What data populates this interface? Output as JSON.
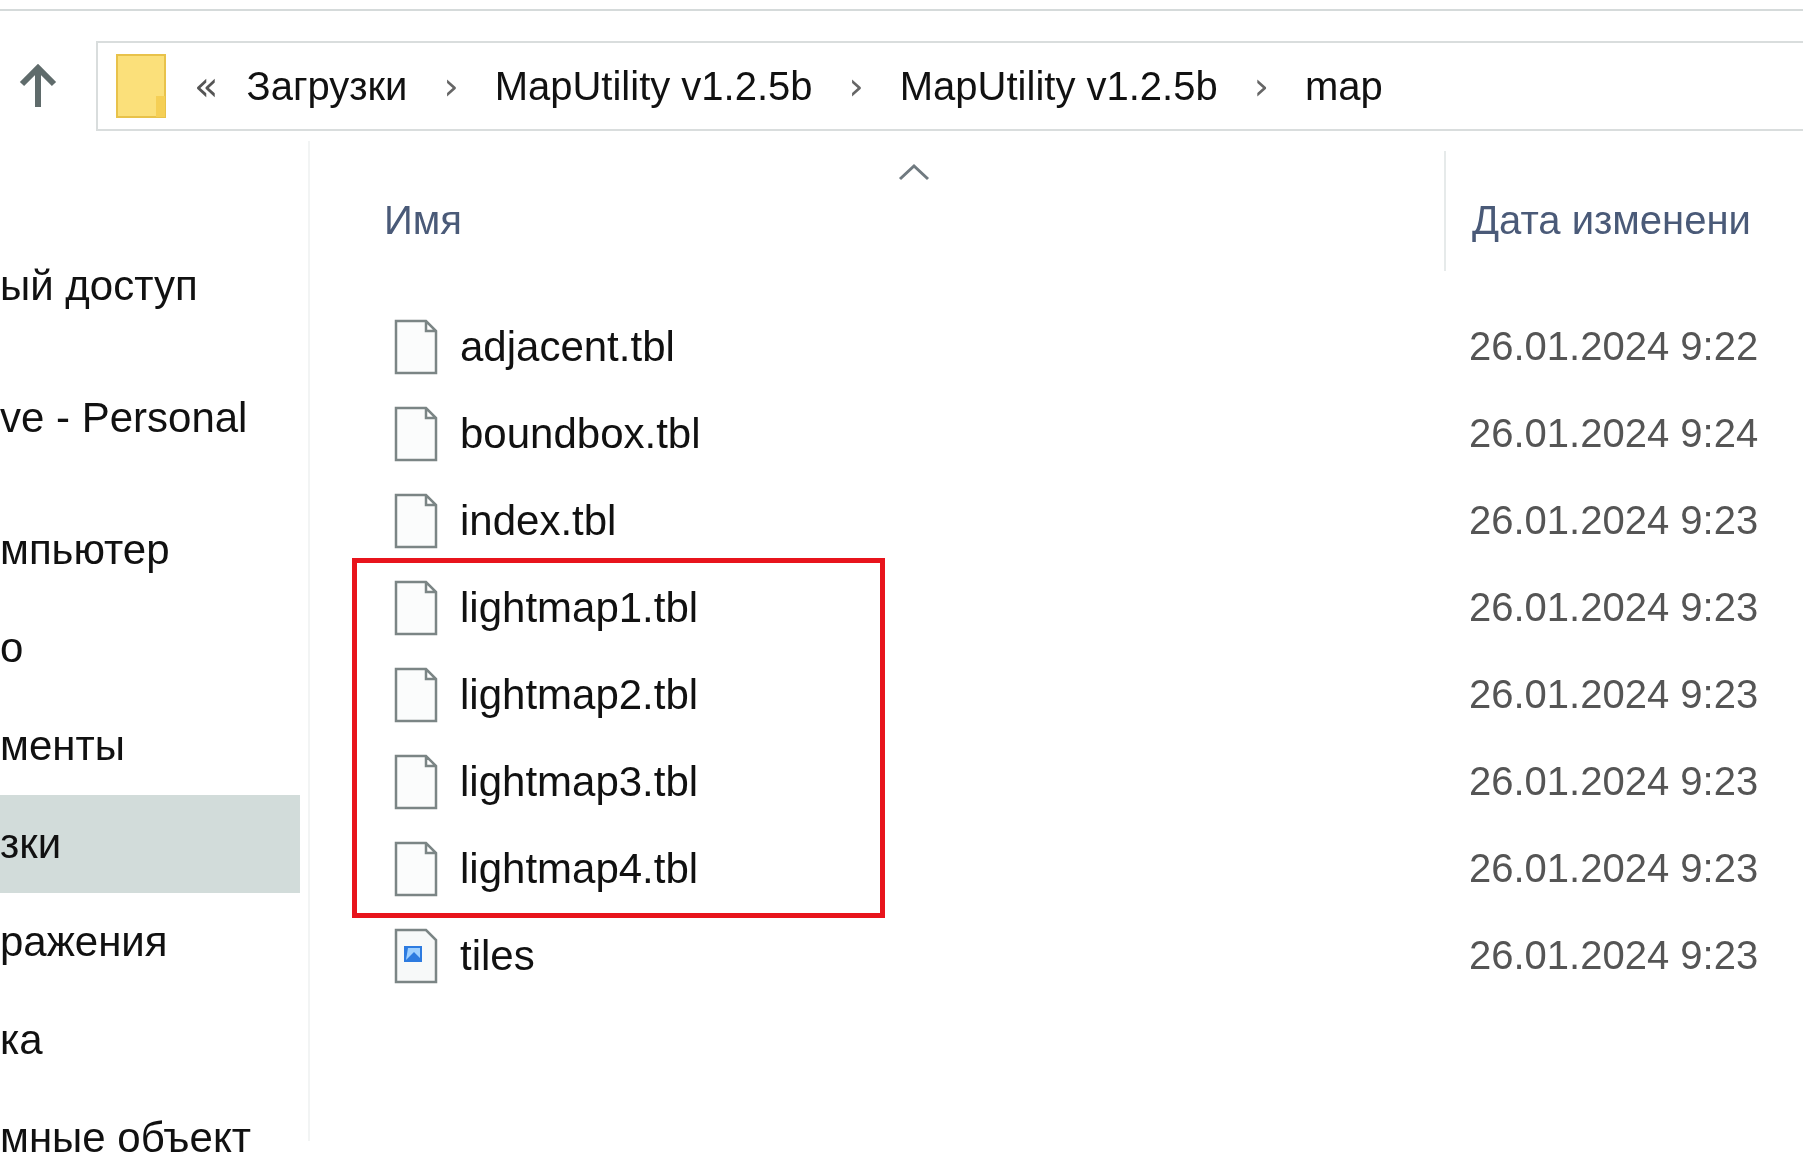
{
  "address_bar": {
    "overflow": "«",
    "crumbs": [
      "Загрузки",
      "MapUtility v1.2.5b",
      "MapUtility v1.2.5b",
      "map"
    ],
    "separator": "›"
  },
  "sidebar": {
    "items": [
      {
        "label": "ый доступ",
        "selected": false
      },
      {
        "label": "ve - Personal",
        "selected": false
      },
      {
        "label": "мпьютер",
        "selected": false
      },
      {
        "label": "о",
        "selected": false
      },
      {
        "label": "менты",
        "selected": false
      },
      {
        "label": "зки",
        "selected": true
      },
      {
        "label": "ражения",
        "selected": false
      },
      {
        "label": "ка",
        "selected": false
      },
      {
        "label": "мные объект",
        "selected": false
      }
    ]
  },
  "columns": [
    {
      "label": "Имя",
      "sorted": true
    },
    {
      "label": "Дата изменени",
      "sorted": false
    }
  ],
  "files": [
    {
      "name": "adjacent.tbl",
      "date": "26.01.2024 9:22",
      "kind": "file",
      "highlighted": false
    },
    {
      "name": "boundbox.tbl",
      "date": "26.01.2024 9:24",
      "kind": "file",
      "highlighted": false
    },
    {
      "name": "index.tbl",
      "date": "26.01.2024 9:23",
      "kind": "file",
      "highlighted": false
    },
    {
      "name": "lightmap1.tbl",
      "date": "26.01.2024 9:23",
      "kind": "file",
      "highlighted": true
    },
    {
      "name": "lightmap2.tbl",
      "date": "26.01.2024 9:23",
      "kind": "file",
      "highlighted": true
    },
    {
      "name": "lightmap3.tbl",
      "date": "26.01.2024 9:23",
      "kind": "file",
      "highlighted": true
    },
    {
      "name": "lightmap4.tbl",
      "date": "26.01.2024 9:23",
      "kind": "file",
      "highlighted": true
    },
    {
      "name": "tiles",
      "date": "26.01.2024 9:23",
      "kind": "image",
      "highlighted": false
    }
  ]
}
